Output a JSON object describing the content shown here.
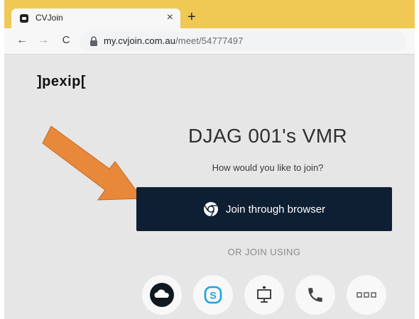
{
  "browser": {
    "tab": {
      "title": "CVJoin",
      "close_label": "×"
    },
    "new_tab_label": "+",
    "nav": {
      "back": "←",
      "forward": "→",
      "reload": "C"
    },
    "address": {
      "host": "my.cvjoin.com.au",
      "path": "/meet/54777497"
    }
  },
  "page": {
    "logo": "]pexip[",
    "room_title": "DJAG 001's VMR",
    "prompt": "How would you like to join?",
    "join_button_label": "Join through browser",
    "alt_join_label": "OR JOIN USING",
    "alt_join_options": [
      "cloud-icon",
      "skype-icon",
      "room-system-icon",
      "phone-icon",
      "more-icon"
    ]
  },
  "colors": {
    "tabstrip": "#f0c955",
    "join_button": "#0f1f33",
    "arrow": "#e8883a",
    "skype": "#1ea3dc"
  },
  "icons": {
    "tab": "cvjoin-favicon",
    "address": "lock-icon",
    "join_button": "chrome-icon",
    "annotation": "orange-arrow"
  }
}
